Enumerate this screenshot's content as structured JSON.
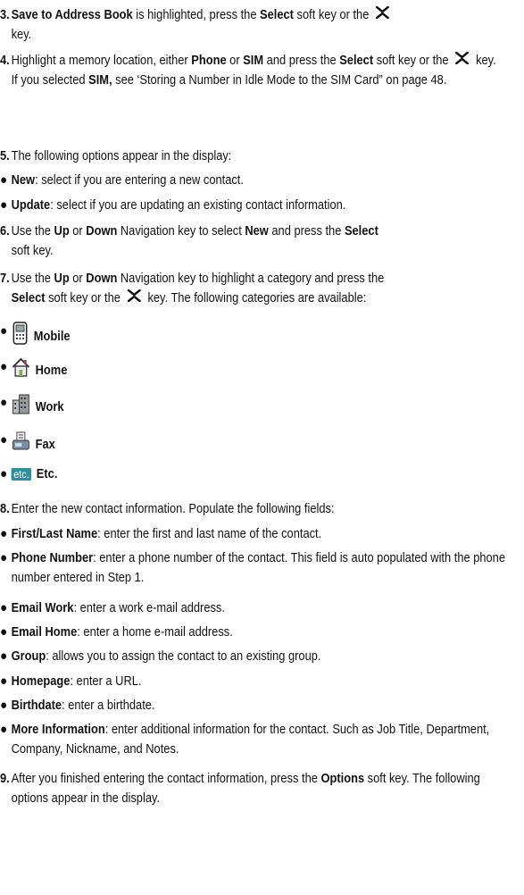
{
  "steps": [
    {
      "num": "3.",
      "bold1": "Save to Address Book",
      "text1": " is highlighted, press the ",
      "bold2": "Select",
      "text2": " soft key or the ",
      "text3": " key."
    },
    {
      "num": "4.",
      "text1": "Highlight a memory location, either ",
      "bold1": "Phone",
      "text2": " or ",
      "bold2": "SIM",
      "text3": " and press the ",
      "bold3": "Select",
      "text4": " soft key or the ",
      "text5": " key.",
      "text6": "If you selected ",
      "bold4": "SIM,",
      "text7": " see ‘Storing a Number in Idle Mode to the SIM Card” on page 48."
    },
    {
      "num": "5.",
      "text1": "The following options appear in the display:"
    },
    {
      "num": "6.",
      "text1": "Use the ",
      "bold1": "Up",
      "text2": " or ",
      "bold2": "Down",
      "text3": " Navigation key to select ",
      "bold3": "New",
      "text4": " and press the ",
      "bold4": "Select",
      "text5": " soft key."
    },
    {
      "num": "7.",
      "text1": "Use the ",
      "bold1": "Up",
      "text2": " or ",
      "bold2": "Down",
      "text3": " Navigation key to highlight a category and press the ",
      "bold3": "Select",
      "text4": " soft key or the ",
      "text5": " key. The following categories are available:"
    },
    {
      "num": "8.",
      "text1": "Enter the new contact information. Populate the following fields:"
    },
    {
      "num": "9.",
      "text1": "After you finished entering the contact information, press the ",
      "bold1": "Options",
      "text2": " soft key. The following options appear in the display."
    }
  ],
  "options": [
    {
      "bold": "New",
      "text": ": select if you are entering a new contact."
    },
    {
      "bold": "Update",
      "text": ": select if you are updating an existing contact information."
    }
  ],
  "categories": [
    {
      "label": "Mobile",
      "icon": "mobile-phone-icon"
    },
    {
      "label": "Home",
      "icon": "house-icon"
    },
    {
      "label": "Work",
      "icon": "office-building-icon"
    },
    {
      "label": "Fax",
      "icon": "fax-machine-icon"
    },
    {
      "label": "Etc.",
      "icon": "etc-icon",
      "badge": "etc."
    }
  ],
  "fields": [
    {
      "bold": "First/Last Name",
      "text": ": enter the first and last name of the contact."
    },
    {
      "bold": "Phone Number",
      "text": ": enter a phone number of the contact.  This field is auto populated with the phone number entered in Step 1."
    },
    {
      "bold": "Email Work",
      "text": ": enter a work e-mail address."
    },
    {
      "bold": "Email Home",
      "text": ": enter a home e-mail address."
    },
    {
      "bold": "Group",
      "text": ": allows you to assign the contact to an existing group."
    },
    {
      "bold": "Homepage",
      "text": ": enter a URL."
    },
    {
      "bold": "Birthdate",
      "text": ": enter a birthdate."
    },
    {
      "bold": "More Information",
      "text": ": enter additional information for the contact. Such as Job Title, Department, Company, Nickname, and Notes."
    }
  ]
}
